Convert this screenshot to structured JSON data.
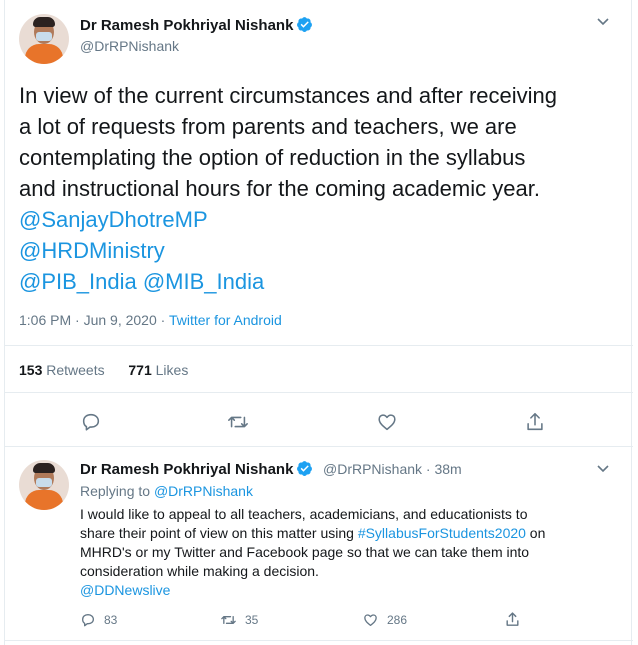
{
  "main_tweet": {
    "author_name": "Dr Ramesh Pokhriyal Nishank",
    "handle": "@DrRPNishank",
    "text_lines": [
      "In view of the current circumstances and after receiving",
      "a lot of requests from parents and teachers, we are",
      "contemplating the option of reduction in the syllabus",
      "and instructional hours for the coming academic year."
    ],
    "mention_lines": [
      "@SanjayDhotreMP",
      "@HRDMinistry",
      "@PIB_India @MIB_India"
    ],
    "time": "1:06 PM · Jun 9, 2020 · ",
    "source": "Twitter for Android",
    "retweets_count": "153",
    "retweets_label": "Retweets",
    "likes_count": "771",
    "likes_label": "Likes"
  },
  "reply_tweet": {
    "author_name": "Dr Ramesh Pokhriyal Nishank",
    "handle_time": "@DrRPNishank · 38m",
    "replying_prefix": "Replying to ",
    "replying_to": "@DrRPNishank",
    "text_line_1": "I would like to appeal to all teachers, academicians, and educationists to",
    "text_line_2_pre": "share their point of view on this matter using ",
    "hashtag": "#SyllabusForStudents2020",
    "text_line_2_post": " on",
    "text_line_3": "MHRD's or my Twitter and Facebook page so that we can take them into",
    "text_line_4": "consideration while making a decision.",
    "mention": "@DDNewslive",
    "reply_count": "83",
    "retweet_count": "35",
    "like_count": "286"
  },
  "icons": [
    "verified-badge-icon",
    "chevron-down-icon",
    "reply-icon",
    "retweet-icon",
    "like-icon",
    "share-icon"
  ],
  "colors": {
    "link": "#1b95e0",
    "secondary_text": "#657786",
    "border": "#e6ecf0",
    "verified": "#1da1f2"
  }
}
